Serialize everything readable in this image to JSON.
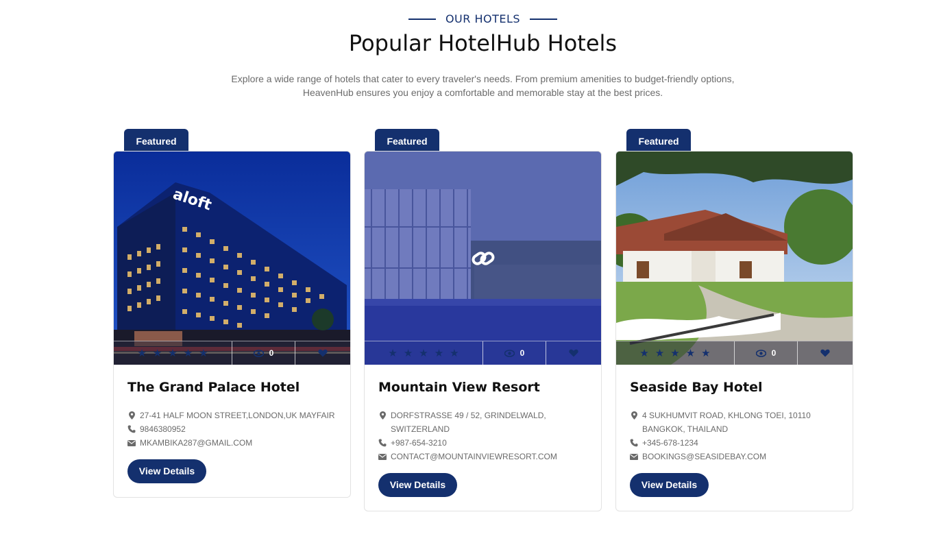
{
  "section": {
    "eyebrow": "OUR HOTELS",
    "title": "Popular HotelHub Hotels",
    "subtitle_line1": "Explore a wide range of hotels that cater to every traveler's needs. From premium amenities to budget-friendly options,",
    "subtitle_line2": "HeavenHub ensures you enjoy a comfortable and memorable stay at the best prices."
  },
  "colors": {
    "brand": "#14306e",
    "text_muted": "#6a6a6a"
  },
  "hotels": [
    {
      "badge": "Featured",
      "name": "The Grand Palace Hotel",
      "address": "27-41 HALF MOON STREET,LONDON,UK MAYFAIR",
      "phone": "9846380952",
      "email": "MKAMBIKA287@GMAIL.COM",
      "rating": 5,
      "views": "0",
      "button": "View Details",
      "sign_text": "aloft"
    },
    {
      "badge": "Featured",
      "name": "Mountain View Resort",
      "address": "DORFSTRASSE 49 / 52, GRINDELWALD, SWITZERLAND",
      "phone": "+987-654-3210",
      "email": "CONTACT@MOUNTAINVIEWRESORT.COM",
      "rating": 5,
      "views": "0",
      "button": "View Details"
    },
    {
      "badge": "Featured",
      "name": "Seaside Bay Hotel",
      "address": "4 SUKHUMVIT ROAD, KHLONG TOEI, 10110 BANGKOK, THAILAND",
      "phone": "+345-678-1234",
      "email": "BOOKINGS@SEASIDEBAY.COM",
      "rating": 5,
      "views": "0",
      "button": "View Details"
    }
  ]
}
